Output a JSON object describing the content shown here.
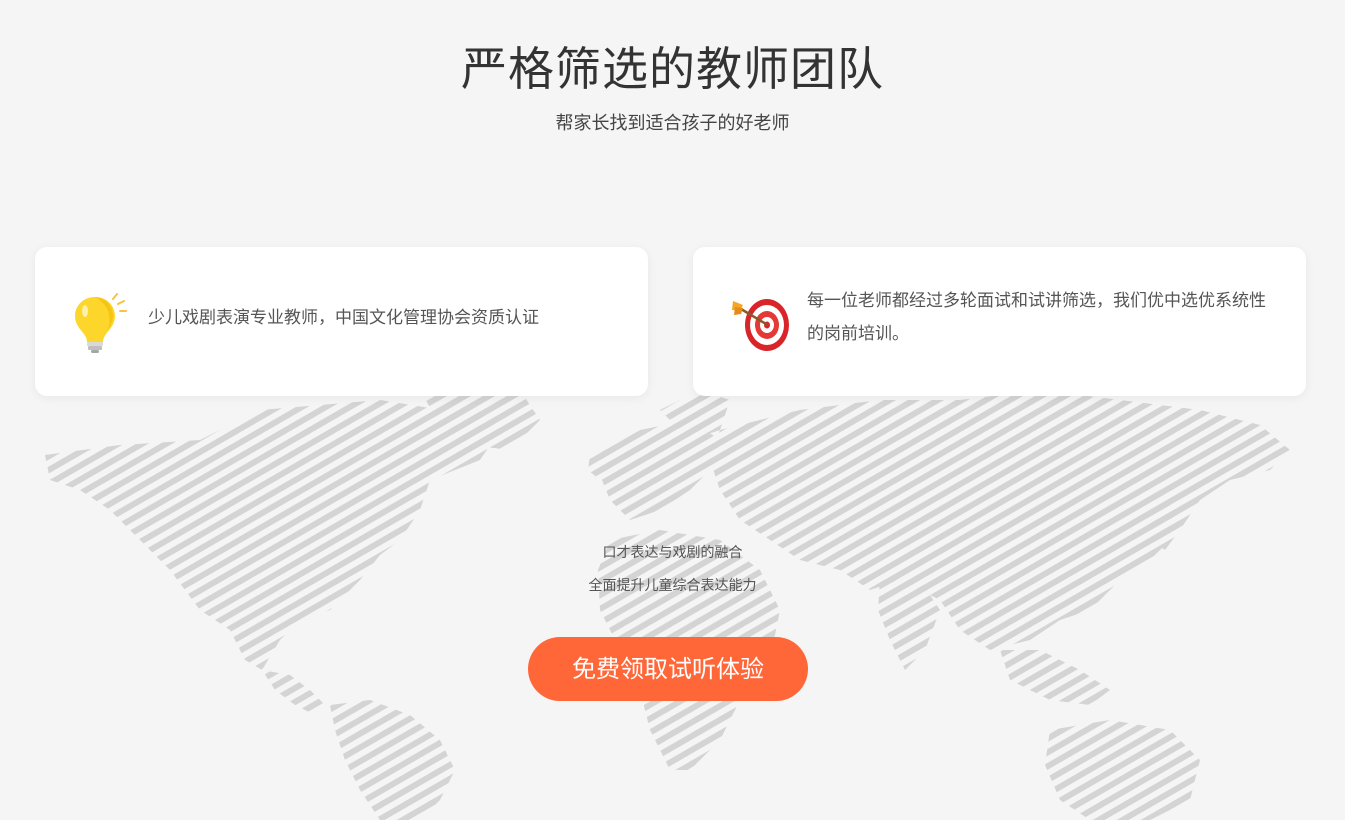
{
  "section": {
    "title": "严格筛选的教师团队",
    "subtitle": "帮家长找到适合孩子的好老师"
  },
  "cards": [
    {
      "icon": "lightbulb-icon",
      "text": "少儿戏剧表演专业教师，中国文化管理协会资质认证"
    },
    {
      "icon": "target-icon",
      "text": "每一位老师都经过多轮面试和试讲筛选，我们优中选优系统性的岗前培训。"
    }
  ],
  "promo": {
    "line1": "口才表达与戏剧的融合",
    "line2": "全面提升儿童综合表达能力",
    "cta_label": "免费领取试听体验"
  },
  "colors": {
    "background": "#f5f5f5",
    "card": "#ffffff",
    "accent": "#ff6638",
    "map_stripes": "#d6d6d6"
  }
}
